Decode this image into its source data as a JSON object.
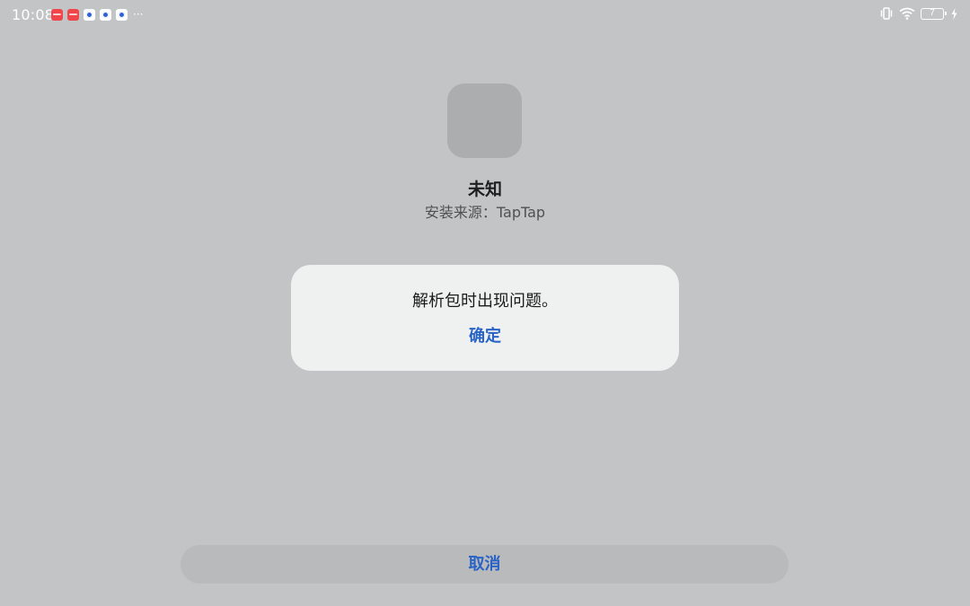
{
  "status_bar": {
    "time": "10:08",
    "notification_icons": [
      "red-app-icon",
      "red-app-icon",
      "baidu-paw-icon",
      "baidu-paw-icon",
      "baidu-paw-icon"
    ],
    "more_indicator": "···",
    "battery_level": "7",
    "system_icons": [
      "vibrate-icon",
      "wifi-icon",
      "battery-icon",
      "charging-icon"
    ]
  },
  "app": {
    "name": "未知",
    "install_source": "安装来源：TapTap"
  },
  "dialog": {
    "message": "解析包时出现问题。",
    "confirm_label": "确定"
  },
  "actions": {
    "cancel_label": "取消"
  },
  "colors": {
    "background": "#c3c4c6",
    "dialog_background": "#eff1f1",
    "accent": "#2a63c6",
    "app_icon_placeholder": "#acadaf"
  }
}
